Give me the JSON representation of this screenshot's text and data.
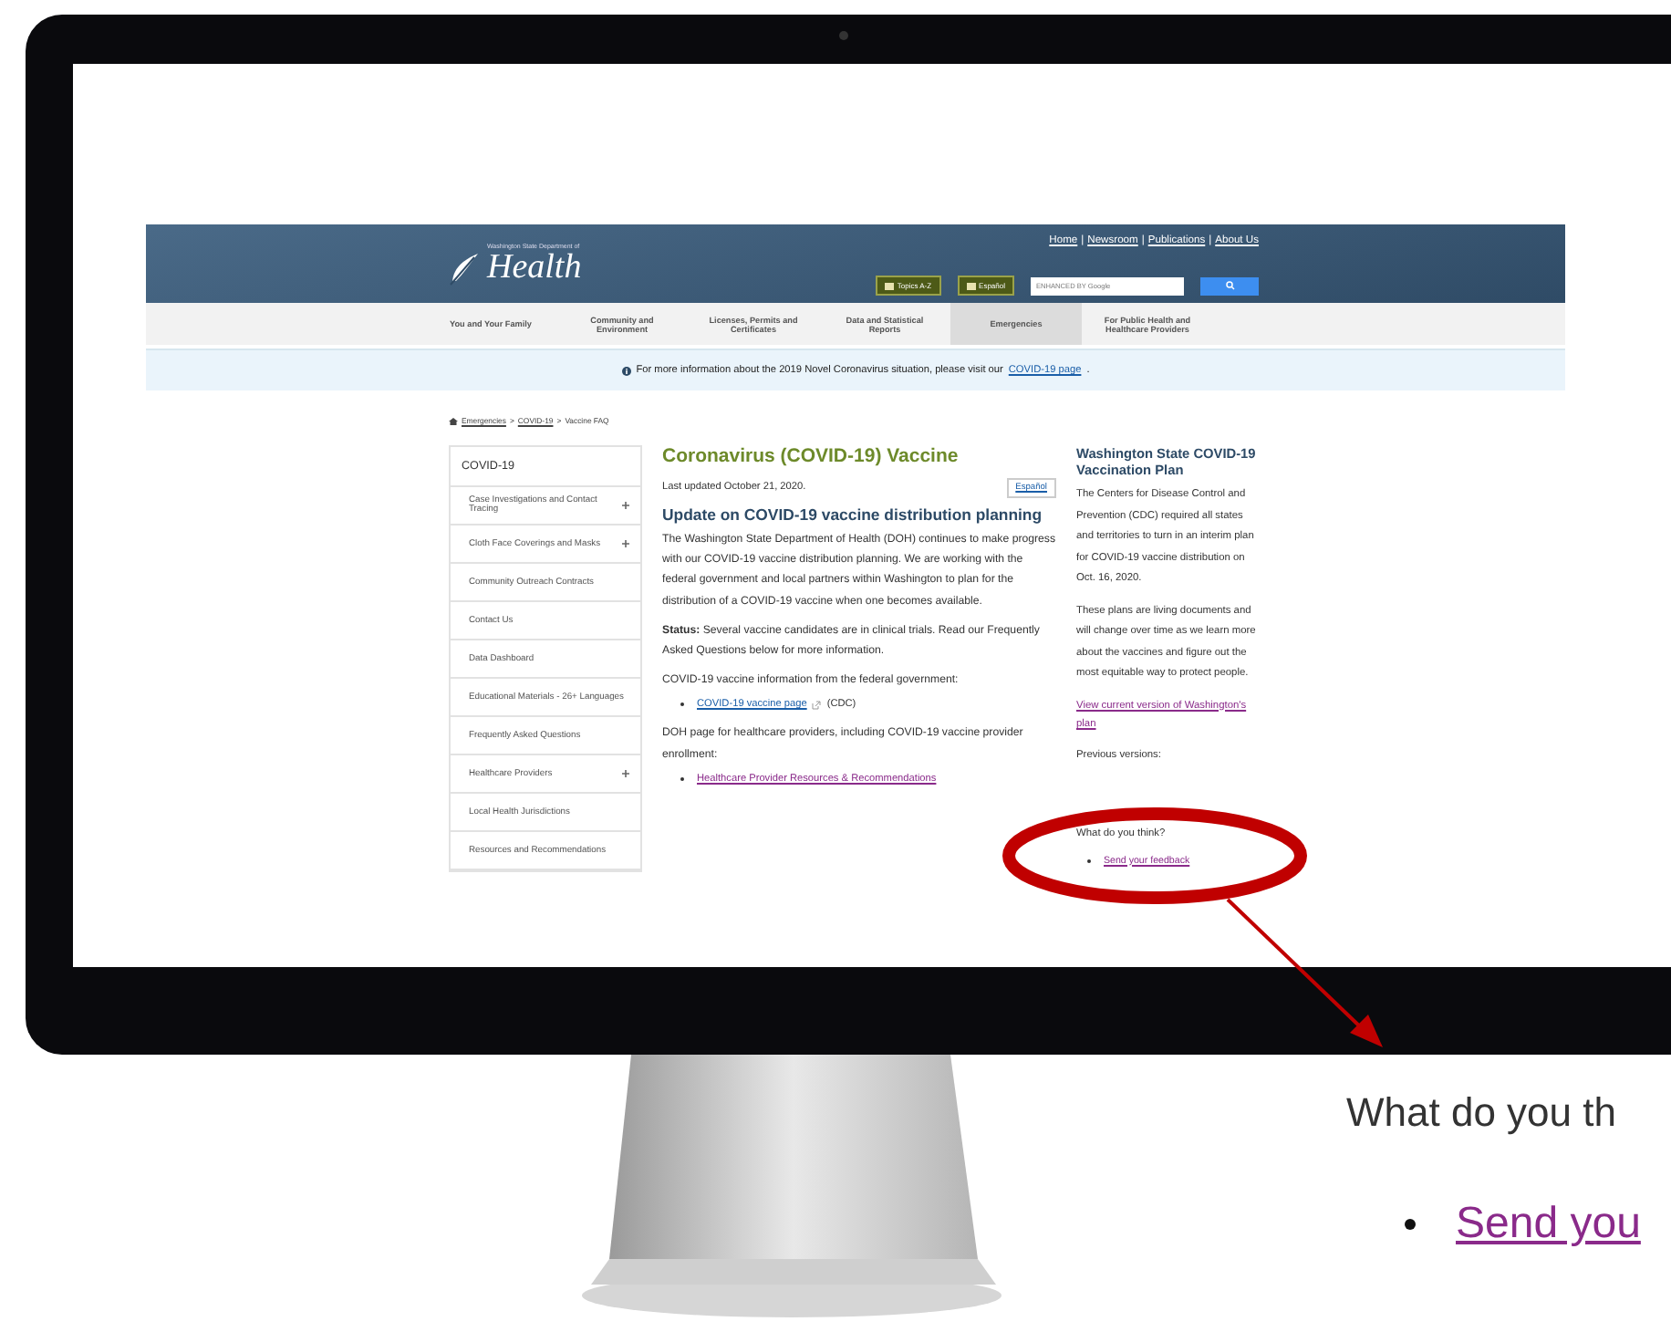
{
  "header": {
    "logo_caption": "Washington State Department of",
    "logo_text": "Health",
    "top_links": [
      "Home",
      "Newsroom",
      "Publications",
      "About Us"
    ],
    "link_separator": "|",
    "buttons": [
      "Topics A-Z",
      "Español"
    ],
    "search": {
      "placeholder": "ENHANCED BY Google"
    }
  },
  "nav": [
    {
      "label": "You and Your Family",
      "selected": false
    },
    {
      "label": "Community and Environment",
      "selected": false
    },
    {
      "label": "Licenses, Permits and Certificates",
      "selected": false
    },
    {
      "label": "Data and Statistical Reports",
      "selected": false
    },
    {
      "label": "Emergencies",
      "selected": true
    },
    {
      "label": "For Public Health and Healthcare Providers",
      "selected": false
    }
  ],
  "banner": {
    "text": "For more information about the 2019 Novel Coronavirus situation, please visit our",
    "link": "COVID-19 page",
    "end": "."
  },
  "breadcrumb": {
    "separator": ">",
    "items": [
      {
        "label": "Emergencies",
        "link": true
      },
      {
        "label": "COVID-19",
        "link": true
      },
      {
        "label": "Vaccine FAQ",
        "link": false
      }
    ]
  },
  "sidebar": {
    "title": "COVID-19",
    "items": [
      {
        "label": "Case Investigations and Contact Tracing",
        "expandable": true
      },
      {
        "label": "Cloth Face Coverings and Masks",
        "expandable": true
      },
      {
        "label": "Community Outreach Contracts",
        "expandable": false
      },
      {
        "label": "Contact Us",
        "expandable": false
      },
      {
        "label": "Data Dashboard",
        "expandable": false
      },
      {
        "label": "Educational Materials - 26+ Languages",
        "expandable": false
      },
      {
        "label": "Frequently Asked Questions",
        "expandable": false
      },
      {
        "label": "Healthcare Providers",
        "expandable": true
      },
      {
        "label": "Local Health Jurisdictions",
        "expandable": false
      },
      {
        "label": "Resources and Recommendations",
        "expandable": false
      }
    ]
  },
  "main": {
    "title": "Coronavirus (COVID-19) Vaccine",
    "updated": "Last updated October 21, 2020.",
    "language_button": "Español",
    "heading": "Update on COVID-19 vaccine distribution planning",
    "blocks": [
      {
        "kind": "paragraph",
        "text": "The Washington State Department of Health (DOH) continues to make progress with our COVID-19 vaccine distribution planning. We are working with the federal government and local partners within Washington to plan for the distribution of a COVID-19 vaccine when one becomes available."
      },
      {
        "kind": "paragraph",
        "text": "**Status:** Several vaccine candidates are in clinical trials. Read our Frequently Asked Questions below for more information."
      },
      {
        "kind": "paragraph",
        "text": "COVID-19 vaccine information from the federal government:"
      },
      {
        "kind": "link",
        "link": "COVID-19 vaccine page",
        "external": true,
        "suffix": "(CDC)"
      },
      {
        "kind": "paragraph",
        "text": "DOH page for healthcare providers, including COVID-19 vaccine provider enrollment:"
      },
      {
        "kind": "link",
        "link": "Healthcare Provider Resources & Recommendations",
        "external": false
      }
    ]
  },
  "aside": {
    "title": "Washington State COVID-19 Vaccination Plan",
    "paragraphs": [
      "The Centers for Disease Control and Prevention (CDC) required all states and territories to turn in an interim plan for COVID-19 vaccine distribution on Oct. 16, 2020.",
      "These plans are living documents and will change over time as we learn more about the vaccines and figure out the most equitable way to protect people."
    ],
    "plan_link": "View current version of Washington's plan",
    "previous_label": "Previous versions:",
    "question": "What do you think?",
    "feedback_link": "Send your feedback"
  },
  "callout": {
    "question": "What do you th",
    "link": "Send you"
  }
}
